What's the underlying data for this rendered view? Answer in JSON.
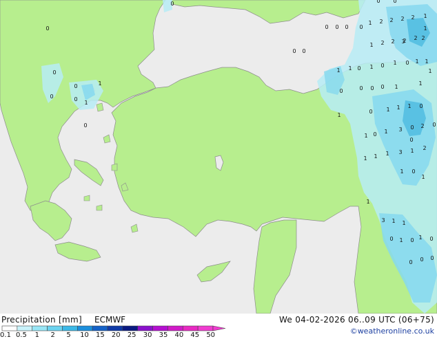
{
  "title": "Precipitation [mm]",
  "model": "ECMWF",
  "valid_time": "We 04-02-2026 06..09 UTC (06+75)",
  "credit": "©weatheronline.co.uk",
  "colors": {
    "sea": "#ececec",
    "land": "#b7ee8e",
    "coast": "#8c8c8c",
    "rain_light": "#b7ecf6",
    "rain_mid": "#86d8ee",
    "rain_heavy": "#50bce0"
  },
  "legend": {
    "ticks": [
      "0.1",
      "0.5",
      "1",
      "2",
      "5",
      "10",
      "15",
      "20",
      "25",
      "30",
      "35",
      "40",
      "45",
      "50"
    ],
    "colors": [
      "#ffffff",
      "#c9f3fb",
      "#98e6f6",
      "#6dd4f0",
      "#3cb9e8",
      "#1c8fdc",
      "#1462c8",
      "#0f3aa8",
      "#0a1a82",
      "#8a11cc",
      "#b40fd0",
      "#d11bc8",
      "#e82ac2",
      "#f03cd0"
    ]
  },
  "map_values": [
    {
      "v": "0"
    },
    {
      "v": "0"
    },
    {
      "v": "0"
    },
    {
      "v": "0"
    },
    {
      "v": "1"
    },
    {
      "v": "0"
    },
    {
      "v": "1"
    },
    {
      "v": "0"
    },
    {
      "v": "0"
    },
    {
      "v": "0"
    },
    {
      "v": "0"
    },
    {
      "v": "0"
    },
    {
      "v": "0"
    },
    {
      "v": "0"
    },
    {
      "v": "0"
    },
    {
      "v": "0"
    },
    {
      "v": "0"
    },
    {
      "v": "1"
    },
    {
      "v": "0"
    },
    {
      "v": "1"
    },
    {
      "v": "0"
    },
    {
      "v": "1"
    },
    {
      "v": "0"
    },
    {
      "v": "1"
    },
    {
      "v": "0"
    },
    {
      "v": "1"
    },
    {
      "v": "1"
    },
    {
      "v": "1"
    },
    {
      "v": "2"
    },
    {
      "v": "2"
    },
    {
      "v": "2"
    },
    {
      "v": "2"
    },
    {
      "v": "1"
    },
    {
      "v": "2"
    },
    {
      "v": "2"
    },
    {
      "v": "3"
    },
    {
      "v": "1"
    },
    {
      "v": "1"
    },
    {
      "v": "2"
    },
    {
      "v": "2"
    },
    {
      "v": "2"
    },
    {
      "v": "0"
    },
    {
      "v": "0"
    },
    {
      "v": "0"
    },
    {
      "v": "1"
    },
    {
      "v": "1"
    },
    {
      "v": "0"
    },
    {
      "v": "1"
    },
    {
      "v": "1"
    },
    {
      "v": "1"
    },
    {
      "v": "0"
    },
    {
      "v": "1"
    },
    {
      "v": "1"
    },
    {
      "v": "1"
    },
    {
      "v": "1"
    },
    {
      "v": "1"
    },
    {
      "v": "3"
    },
    {
      "v": "1"
    },
    {
      "v": "2"
    },
    {
      "v": "1"
    },
    {
      "v": "0"
    },
    {
      "v": "1"
    },
    {
      "v": "3"
    },
    {
      "v": "0"
    },
    {
      "v": "2"
    },
    {
      "v": "0"
    },
    {
      "v": "0"
    },
    {
      "v": "1"
    },
    {
      "v": "0"
    },
    {
      "v": "1"
    },
    {
      "v": "3"
    },
    {
      "v": "1"
    },
    {
      "v": "1"
    },
    {
      "v": "0"
    },
    {
      "v": "1"
    },
    {
      "v": "0"
    },
    {
      "v": "1"
    },
    {
      "v": "0"
    },
    {
      "v": "0"
    },
    {
      "v": "0"
    },
    {
      "v": "0"
    },
    {
      "v": "1"
    }
  ]
}
